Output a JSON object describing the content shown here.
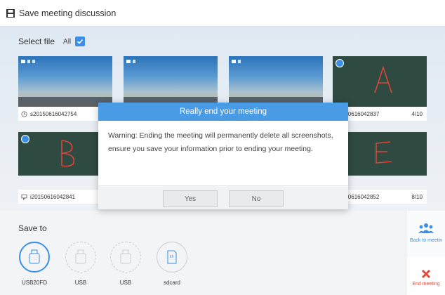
{
  "header": {
    "title": "Save meeting discussion",
    "icon": "floppy-disk-icon"
  },
  "select": {
    "label": "Select file",
    "all_label": "All",
    "all_checked": true
  },
  "files": [
    {
      "name": "",
      "page": "",
      "kind": "screenshot",
      "checked": true
    },
    {
      "name": "",
      "page": "",
      "kind": "screenshot",
      "checked": true
    },
    {
      "name": "",
      "page": "",
      "kind": "screenshot",
      "checked": true
    },
    {
      "name": "20150616042837",
      "page": "4/10",
      "kind": "whiteboard",
      "letter": "A",
      "checked": true
    },
    {
      "name": "20150616042841",
      "page": "",
      "kind": "whiteboard",
      "letter": "B",
      "checked": true
    },
    {
      "name": "20150616042852",
      "page": "8/10",
      "kind": "whiteboard",
      "letter": "E",
      "checked": false
    }
  ],
  "first_label": {
    "name": "s20150616042754"
  },
  "row2_label": {
    "name": "i20150616042841"
  },
  "save_to": {
    "label": "Save to",
    "devices": [
      {
        "label": "USB20FD",
        "active": true
      },
      {
        "label": "USB",
        "active": false
      },
      {
        "label": "USB",
        "active": false
      },
      {
        "label": "sdcard",
        "active": false
      }
    ]
  },
  "right_panel": {
    "back_label": "Back to meetin",
    "end_label": "End meeting"
  },
  "dialog": {
    "title": "Really end your meeting",
    "message": "Warning: Ending the meeting will permanently delete all screenshots, ensure you save your information prior to ending your meeting.",
    "yes": "Yes",
    "no": "No"
  },
  "colors": {
    "accent": "#4a9be6",
    "danger": "#e24a3b",
    "board": "#2f4a40",
    "ink": "#d9463a"
  }
}
